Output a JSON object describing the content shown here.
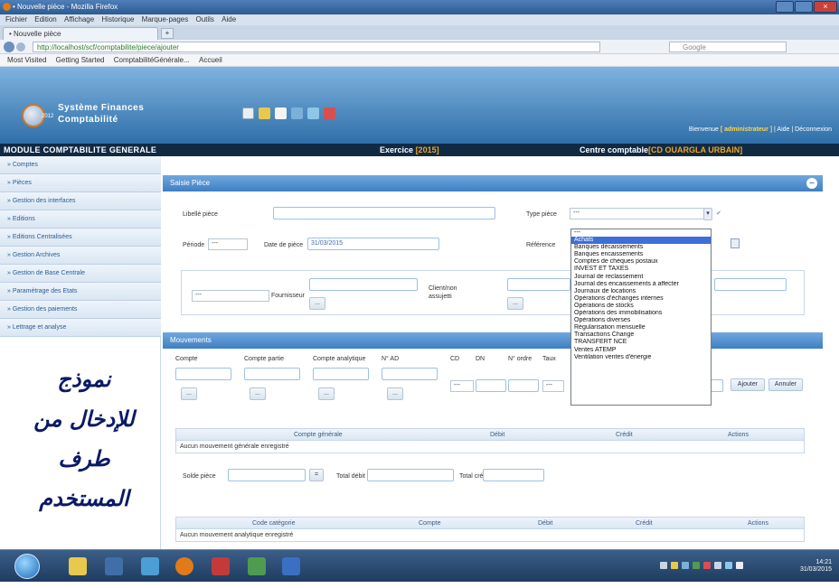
{
  "browser": {
    "window_title": "• Nouvelle pièce - Mozilla Firefox",
    "menu": [
      "Fichier",
      "Edition",
      "Affichage",
      "Historique",
      "Marque-pages",
      "Outils",
      "Aide"
    ],
    "tab_label": "• Nouvelle pièce",
    "tab_new": "+",
    "url": "http://localhost/scf/comptabilite/piece/ajouter",
    "search_placeholder": "Google",
    "bookmarks": [
      "Most Visited",
      "Getting Started",
      "ComptabilitéGénérale...",
      "Accueil"
    ]
  },
  "app": {
    "title_line1": "Système Finances",
    "title_line2": "Comptabilité",
    "logo_badge": "2012",
    "welcome_prefix": "Bienvenue",
    "welcome_user": "[ administrateur ]",
    "welcome_links": "| Aide | Déconnexion"
  },
  "modulebar": {
    "module": "MODULE COMPTABILITE GENERALE",
    "exercice_label": "Exercice",
    "exercice_value": "[2015]",
    "centre_label": "Centre comptable",
    "centre_value": "[CD OUARGLA URBAIN]"
  },
  "sidebar": {
    "items": [
      "» Comptes",
      "» Pièces",
      "» Gestion des interfaces",
      "» Editions",
      "» Editions Centralisées",
      "» Gestion Archives",
      "» Gestion de Base Centrale",
      "» Paramétrage des Etats",
      "» Gestion des paiements",
      "» Lettrage et analyse"
    ],
    "arabic_note": [
      "نموذج",
      "للإدخال من",
      "طرف",
      "المستخدم"
    ]
  },
  "form": {
    "panel_title": "Saisie Pièce",
    "collapse": "–",
    "libelle_label": "Libellé pièce",
    "type_label": "Type pièce",
    "type_value": "---",
    "periode_label": "Période",
    "periode_value": "---",
    "date_label": "Date de pièce",
    "date_value": "31/03/2015",
    "reference_label": "Référence",
    "fournisseur_value": "---",
    "fournisseur_label": "Fournisseur",
    "client_label": "Client/non",
    "client_label2": "assujetti",
    "small_btn": "..."
  },
  "dropdown": {
    "options": [
      "---",
      "Achats",
      "Banques décaissements",
      "Banques encaissements",
      "Comptes de chèques postaux",
      "INVEST ET TAXES",
      "Journal de reclassement",
      "Journal des encaissements à affecter",
      "Journaux de locations",
      "Opérations d'échanges internes",
      "Opérations de stocks",
      "Opérations des immobilisations",
      "Opérations diverses",
      "Régularisation mensuelle",
      "Transactions Change",
      "TRANSFERT NCE",
      "Ventes ATEMP",
      "Ventilation ventes d'énergie"
    ],
    "highlighted": "Achats"
  },
  "mouvements": {
    "panel_title": "Mouvements",
    "labels": [
      "Compte",
      "Compte partie",
      "Compte analytique",
      "N° AD",
      "CD",
      "DN",
      "N° ordre",
      "Taux"
    ],
    "small_btn": "...",
    "sel_value": "---",
    "ajouter": "Ajouter",
    "annuler": "Annuler"
  },
  "table1": {
    "headers": [
      "Compte générale",
      "Débit",
      "Crédit",
      "Actions"
    ],
    "empty": "Aucun mouvement générale enregistré"
  },
  "totals": {
    "solde_label": "Solde pièce",
    "debit_label": "Total débit",
    "credit_label": "Total crédit",
    "btn": "="
  },
  "table2": {
    "headers": [
      "Code catégorie",
      "Compte",
      "Débit",
      "Crédit",
      "Actions"
    ],
    "empty": "Aucun mouvement analytique enregistré"
  },
  "taskbar": {
    "time": "14:21",
    "date": "31/03/2015"
  },
  "colors": {
    "header_blue": "#2f6fa8",
    "module_bar": "#102a44",
    "accent_orange": "#f0a51e",
    "dropdown_highlight": "#3d6fd8"
  }
}
